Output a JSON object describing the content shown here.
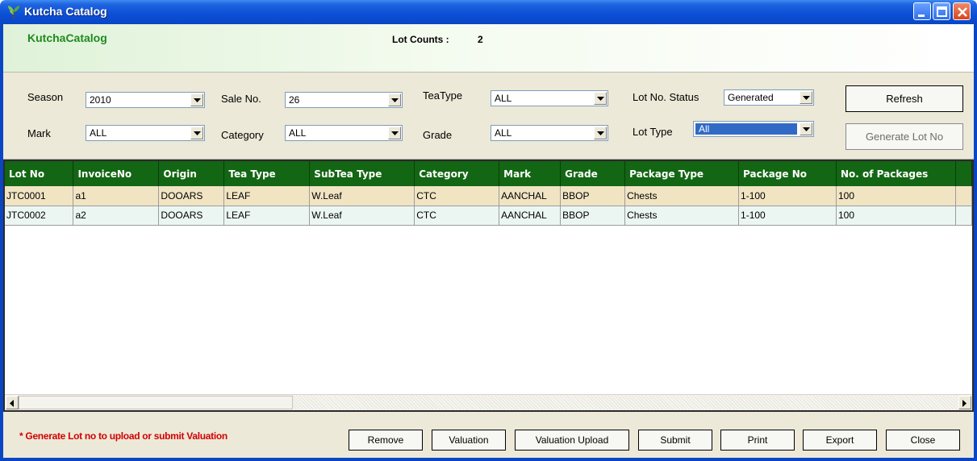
{
  "window": {
    "title": "Kutcha Catalog"
  },
  "header": {
    "brand": "KutchaCatalog",
    "lot_counts_label": "Lot Counts :",
    "lot_counts_value": "2"
  },
  "filters": {
    "season": {
      "label": "Season",
      "value": "2010"
    },
    "sale_no": {
      "label": "Sale No.",
      "value": "26"
    },
    "tea_type": {
      "label": "TeaType",
      "value": "ALL"
    },
    "lot_no_status": {
      "label": "Lot No. Status",
      "value": "Generated"
    },
    "mark": {
      "label": "Mark",
      "value": "ALL"
    },
    "category": {
      "label": "Category",
      "value": "ALL"
    },
    "grade": {
      "label": "Grade",
      "value": "ALL"
    },
    "lot_type": {
      "label": "Lot Type",
      "value": "All"
    },
    "refresh_label": "Refresh",
    "generate_label": "Generate Lot No"
  },
  "grid": {
    "columns": [
      "Lot No",
      "InvoiceNo",
      "Origin",
      "Tea Type",
      "SubTea Type",
      "Category",
      "Mark",
      "Grade",
      "Package Type",
      "Package No",
      "No. of Packages"
    ],
    "rows": [
      [
        "JTC0001",
        "a1",
        "DOOARS",
        "LEAF",
        "W.Leaf",
        "CTC",
        "AANCHAL",
        "BBOP",
        "Chests",
        "1-100",
        "100"
      ],
      [
        "JTC0002",
        "a2",
        "DOOARS",
        "LEAF",
        "W.Leaf",
        "CTC",
        "AANCHAL",
        "BBOP",
        "Chests",
        "1-100",
        "100"
      ]
    ]
  },
  "footer": {
    "note": "* Generate Lot no to upload or submit Valuation",
    "buttons": {
      "remove": "Remove",
      "valuation": "Valuation",
      "valuation_upload": "Valuation Upload",
      "submit": "Submit",
      "print": "Print",
      "export": "Export",
      "close": "Close"
    }
  },
  "colors": {
    "titlebar": "#0b4fd6",
    "grid_header": "#136613",
    "row_selected": "#f1e4c3",
    "row_alt": "#ebf6f3",
    "note": "#d10000",
    "brand": "#1f8a1f"
  },
  "icons": [
    "tea-leaf-icon",
    "minimize-icon",
    "maximize-icon",
    "close-icon",
    "dropdown-arrow-icon",
    "scroll-left-icon",
    "scroll-right-icon"
  ]
}
